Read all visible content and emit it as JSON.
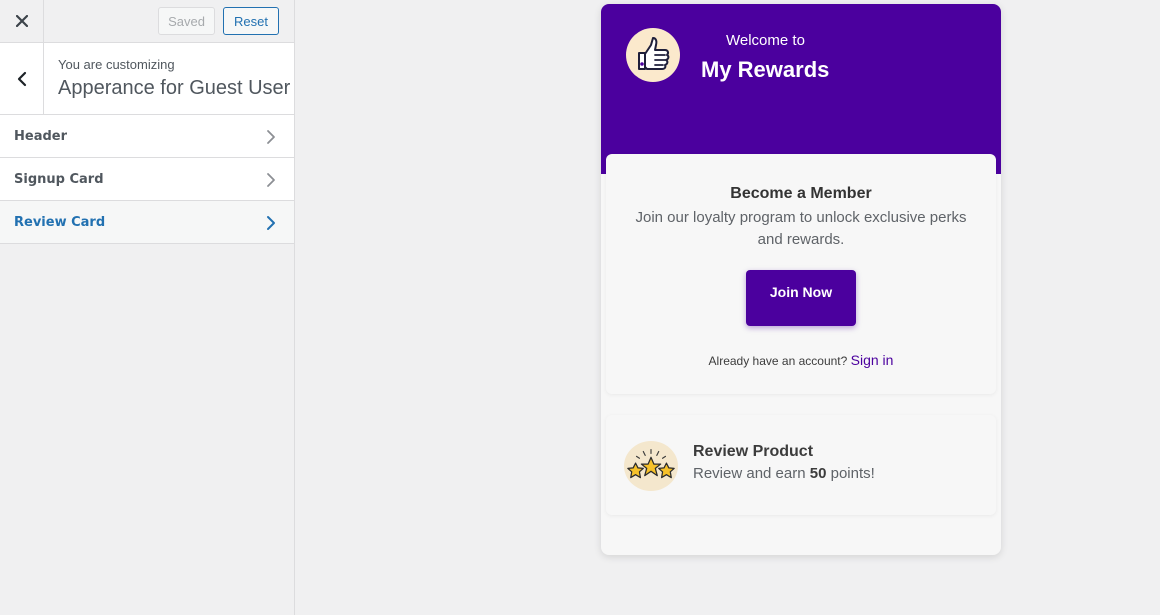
{
  "customizer": {
    "saved_label": "Saved",
    "reset_label": "Reset",
    "customizing_label": "You are customizing",
    "section_title": "Apperance for Guest User",
    "menu": [
      {
        "label": "Header"
      },
      {
        "label": "Signup Card"
      },
      {
        "label": "Review Card"
      }
    ],
    "active_item": "Review Card"
  },
  "preview": {
    "welcome": "Welcome to",
    "title": "My Rewards",
    "signup": {
      "title": "Become a Member",
      "description": "Join our loyalty program to unlock exclusive perks and rewards.",
      "button": "Join Now",
      "account_text": "Already have an account?",
      "signin_link": "Sign in"
    },
    "review": {
      "title": "Review Product",
      "desc_prefix": "Review and earn",
      "points": "50",
      "desc_suffix": "points!"
    }
  },
  "colors": {
    "brand": "#4b009e",
    "accent_link": "#2271b1",
    "panel_bg": "#f0f0f1"
  },
  "icons": [
    "close-icon",
    "back-chevron-icon",
    "chevron-right-icon",
    "thumbs-up-icon",
    "stars-icon"
  ]
}
